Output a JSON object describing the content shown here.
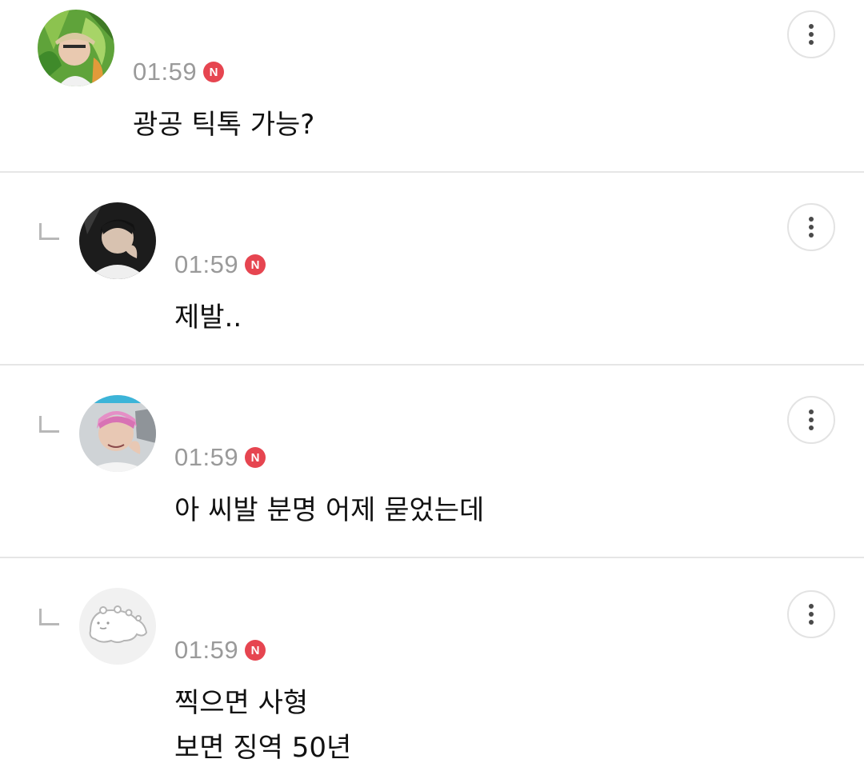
{
  "comments": [
    {
      "avatar_icon": "user-avatar-photo-green-leaves",
      "time": "01:59",
      "badge": "N",
      "is_reply": false,
      "lines": [
        "광공 틱톡 가능?"
      ]
    },
    {
      "avatar_icon": "user-avatar-photo-dark",
      "time": "01:59",
      "badge": "N",
      "is_reply": true,
      "lines": [
        "제발.."
      ]
    },
    {
      "avatar_icon": "user-avatar-photo-pink-hair",
      "time": "01:59",
      "badge": "N",
      "is_reply": true,
      "lines": [
        "아 씨발 분명 어제 묻었는데"
      ]
    },
    {
      "avatar_icon": "default-avatar-character",
      "time": "01:59",
      "badge": "N",
      "is_reply": true,
      "lines": [
        "찍으면 사형",
        "보면 징역 50년"
      ]
    }
  ],
  "colors": {
    "badge": "#e64550",
    "time": "#9a9a9a",
    "divider": "#e6e6e6"
  }
}
